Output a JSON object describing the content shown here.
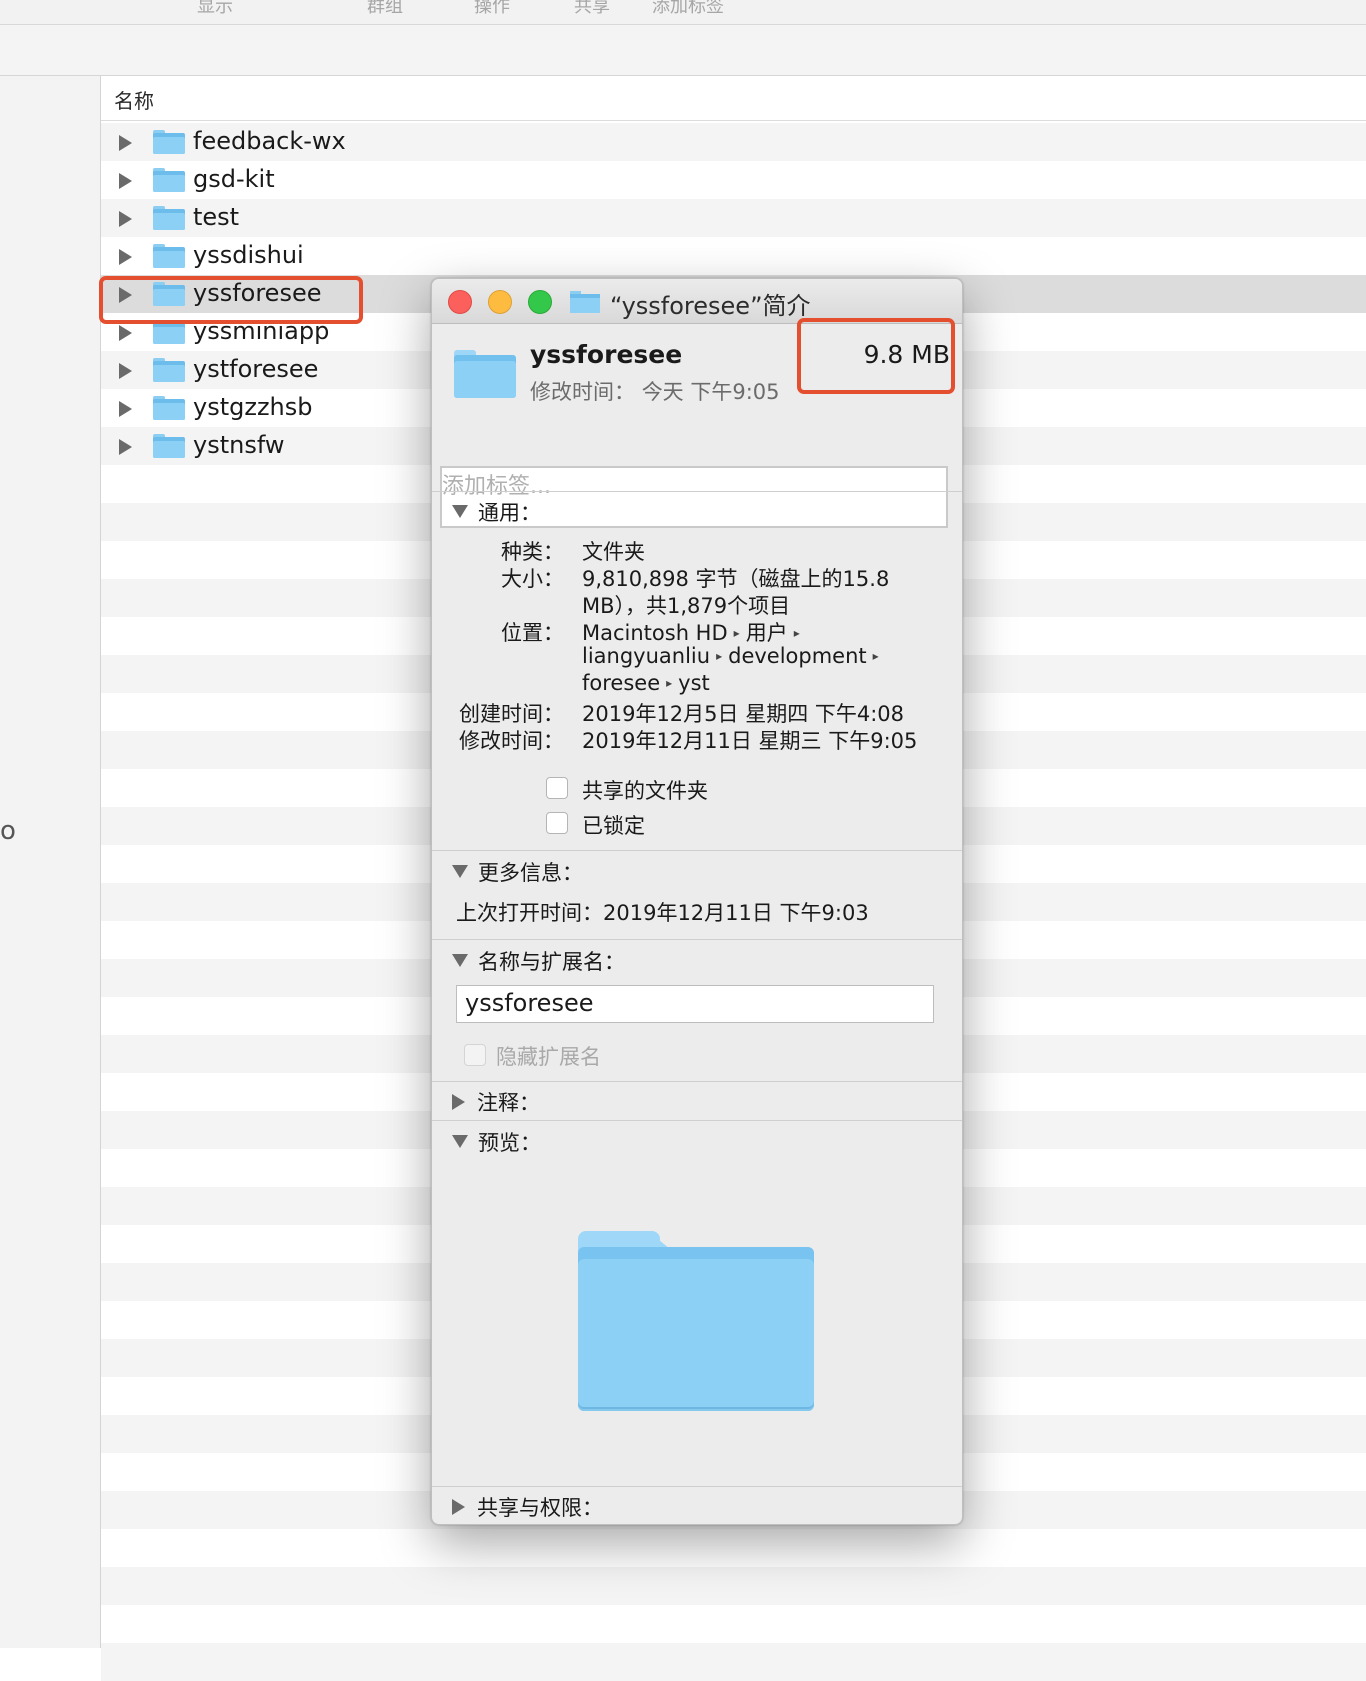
{
  "toolbar": {
    "items": [
      "显示",
      "群组",
      "操作",
      "共享",
      "添加标签"
    ]
  },
  "sidebar": {
    "fragment": "o"
  },
  "filelist": {
    "column_header": "名称",
    "rows": [
      {
        "name": "feedback-wx",
        "selected": false
      },
      {
        "name": "gsd-kit",
        "selected": false
      },
      {
        "name": "test",
        "selected": false
      },
      {
        "name": "yssdishui",
        "selected": false
      },
      {
        "name": "yssforesee",
        "selected": true
      },
      {
        "name": "yssminiapp",
        "selected": false
      },
      {
        "name": "ystforesee",
        "selected": false
      },
      {
        "name": "ystgzzhsb",
        "selected": false
      },
      {
        "name": "ystnsfw",
        "selected": false
      }
    ]
  },
  "info_window": {
    "title": "“yssforesee”简介",
    "file_name": "yssforesee",
    "modified_label": "修改时间：",
    "modified_value": "今天 下午9:05",
    "size": "9.8 MB",
    "tags_placeholder": "添加标签...",
    "general": {
      "header": "通用：",
      "kind_label": "种类：",
      "kind_value": "文件夹",
      "size_label": "大小：",
      "size_line1": "9,810,898 字节（磁盘上的15.8",
      "size_line2": "MB），共1,879个项目",
      "where_label": "位置：",
      "where_line1": [
        "Macintosh HD",
        "用户",
        ""
      ],
      "where_line2": [
        "liangyuanliu",
        "development",
        ""
      ],
      "where_line3": [
        "foresee",
        "yst"
      ],
      "created_label": "创建时间：",
      "created_value": "2019年12月5日 星期四 下午4:08",
      "modified_label": "修改时间：",
      "modified_value": "2019年12月11日 星期三 下午9:05",
      "shared_folder_label": "共享的文件夹",
      "shared_folder_checked": false,
      "locked_label": "已锁定",
      "locked_checked": false
    },
    "more_info": {
      "header": "更多信息：",
      "last_opened": "上次打开时间：2019年12月11日 下午9:03"
    },
    "name_ext": {
      "header": "名称与扩展名：",
      "value": "yssforesee",
      "hide_ext_label": "隐藏扩展名",
      "hide_ext_checked": false
    },
    "comments_header": "注释：",
    "preview_header": "预览：",
    "sharing_header": "共享与权限："
  },
  "colors": {
    "highlight": "#e4502f",
    "folder": "#8dd0f5",
    "traffic_red": "#fc605c",
    "traffic_yellow": "#fdbc40",
    "traffic_green": "#34c84a"
  }
}
